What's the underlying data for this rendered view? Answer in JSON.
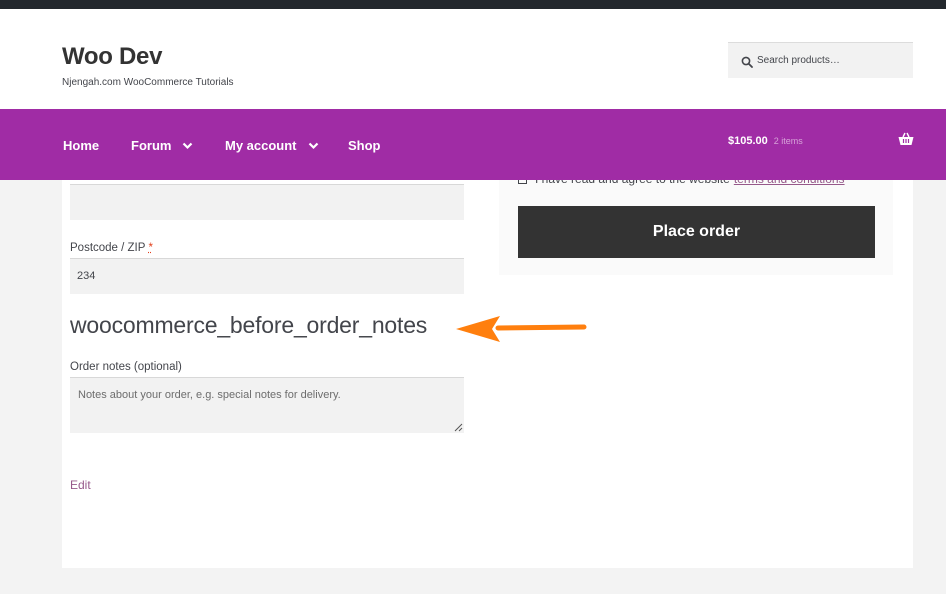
{
  "site": {
    "title": "Woo Dev",
    "tagline": "Njengah.com WooCommerce Tutorials"
  },
  "search": {
    "placeholder": "Search products…",
    "icon": "search-icon"
  },
  "nav": {
    "items": [
      {
        "label": "Home",
        "has_dropdown": false
      },
      {
        "label": "Forum",
        "has_dropdown": true
      },
      {
        "label": "My account",
        "has_dropdown": true
      },
      {
        "label": "Shop",
        "has_dropdown": false
      }
    ],
    "cart": {
      "amount": "$105.00",
      "count": "2 items",
      "icon": "basket-icon"
    }
  },
  "form": {
    "postcode_label": "Postcode / ZIP",
    "required_mark": "*",
    "postcode_value": "234",
    "hook_title": "woocommerce_before_order_notes",
    "notes_label": "Order notes (optional)",
    "notes_placeholder": "Notes about your order, e.g. special notes for delivery.",
    "edit_label": "Edit"
  },
  "order": {
    "terms_text": "I have read and agree to the website",
    "terms_link": "terms and conditions",
    "place_order_label": "Place order"
  },
  "colors": {
    "nav_bg": "#a02ca5",
    "button_bg": "#333333",
    "arrow": "#ff7f0e",
    "link": "#96588a"
  }
}
